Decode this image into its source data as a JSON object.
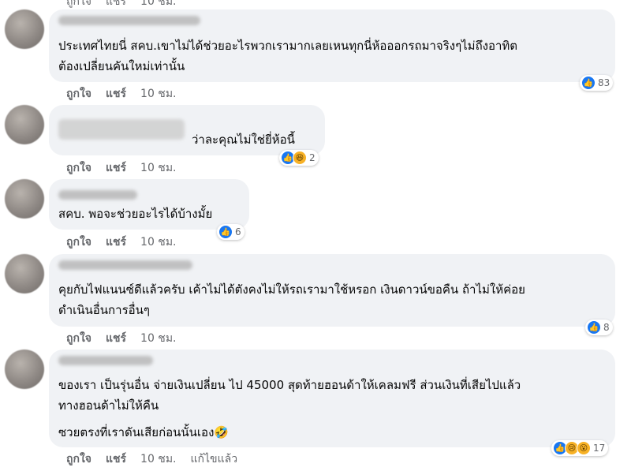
{
  "top_cropped": {
    "like": "ถูกใจ",
    "share": "แชร์",
    "time": "10 ชม."
  },
  "comments": [
    {
      "text": "ประเทศไทยนี่ สคบ.เขาไม่ได้ช่วยอะไรพวกเรามากเลยเหนทุกนี่ห้อออกรถมาจริงๆไม่ถึงอาทิต\nต้องเปลี่ยนคันใหม่เท่านั้น",
      "like_label": "ถูกใจ",
      "share_label": "แชร์",
      "time": "10 ชม.",
      "reactions": [
        "like-icon"
      ],
      "reaction_count": "83"
    },
    {
      "text": "ว่าละคุณไม่ใช่ยี่ห้อนี้",
      "like_label": "ถูกใจ",
      "share_label": "แชร์",
      "time": "10 ชม.",
      "reactions": [
        "like-icon",
        "haha-icon"
      ],
      "reaction_count": "2"
    },
    {
      "text": "สคบ. พอจะช่วยอะไรได้บ้างมั้ย",
      "like_label": "ถูกใจ",
      "share_label": "แชร์",
      "time": "10 ชม.",
      "reactions": [
        "like-icon"
      ],
      "reaction_count": "6"
    },
    {
      "text": "คุยกับไฟแนนซ์ดีแล้วครับ เค้าไม่ได้ตังคงไม่ให้รถเรามาใช้หรอก เงินดาวน์ขอคืน ถ้าไม่ให้ค่อย\nดำเนินอื่นการอื่นๆ",
      "like_label": "ถูกใจ",
      "share_label": "แชร์",
      "time": "10 ชม.",
      "reactions": [
        "like-icon"
      ],
      "reaction_count": "8"
    },
    {
      "text": "ของเรา เป็นรุ่นอื่น จ่ายเงินเปลี่ยน ไป 45000 สุดท้ายฮอนด้าให้เคลมฟรี ส่วนเงินที่เสียไปแล้ว\nทางฮอนด้าไม่ให้คืน",
      "text2": "ซวยตรงที่เราดันเสียก่อนนั้นเอง🤣",
      "like_label": "ถูกใจ",
      "share_label": "แชร์",
      "time": "10 ชม.",
      "edited": "แก้ไขแล้ว",
      "reactions": [
        "like-icon",
        "sad-icon",
        "wow-icon"
      ],
      "reaction_count": "17"
    }
  ],
  "colors": {
    "bubble": "#f0f2f5",
    "like_blue": "#1877f2",
    "meta_text": "#65676b"
  }
}
